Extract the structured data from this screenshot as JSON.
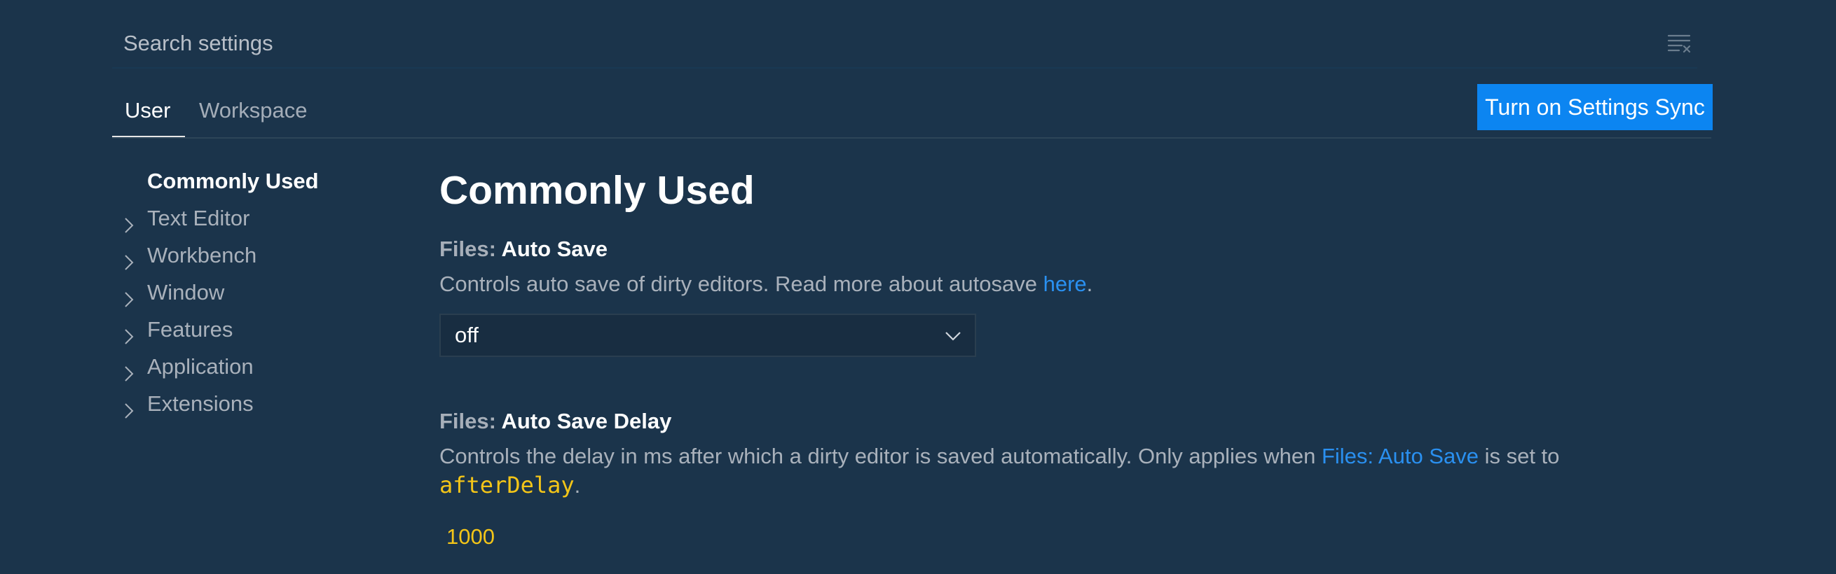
{
  "search": {
    "placeholder": "Search settings",
    "clear_icon": "clear-filter-icon"
  },
  "tabs": [
    {
      "label": "User",
      "active": true
    },
    {
      "label": "Workspace",
      "active": false
    }
  ],
  "sync_button": {
    "label": "Turn on Settings Sync"
  },
  "sidebar": {
    "items": [
      {
        "label": "Commonly Used",
        "active": true,
        "icon": ""
      },
      {
        "label": "Text Editor",
        "active": false,
        "icon": "chevron-right-icon"
      },
      {
        "label": "Workbench",
        "active": false,
        "icon": "chevron-right-icon"
      },
      {
        "label": "Window",
        "active": false,
        "icon": "chevron-right-icon"
      },
      {
        "label": "Features",
        "active": false,
        "icon": "chevron-right-icon"
      },
      {
        "label": "Application",
        "active": false,
        "icon": "chevron-right-icon"
      },
      {
        "label": "Extensions",
        "active": false,
        "icon": "chevron-right-icon"
      }
    ]
  },
  "main": {
    "section_title": "Commonly Used",
    "auto_save": {
      "category": "Files: ",
      "name": "Auto Save",
      "description_prefix": "Controls auto save of dirty editors. Read more about autosave ",
      "description_link": "here",
      "description_suffix": ".",
      "value": "off"
    },
    "auto_save_delay": {
      "category": "Files: ",
      "name": "Auto Save Delay",
      "description_prefix": "Controls the delay in ms after which a dirty editor is saved automatically. Only applies when ",
      "description_link": "Files: Auto Save",
      "description_middle": " is set to",
      "description_code": "afterDelay",
      "description_suffix": ".",
      "value": "1000"
    }
  },
  "colors": {
    "background": "#1b344b",
    "accent": "#0c85f1",
    "link": "#2a90f0",
    "code": "#f3c518"
  }
}
